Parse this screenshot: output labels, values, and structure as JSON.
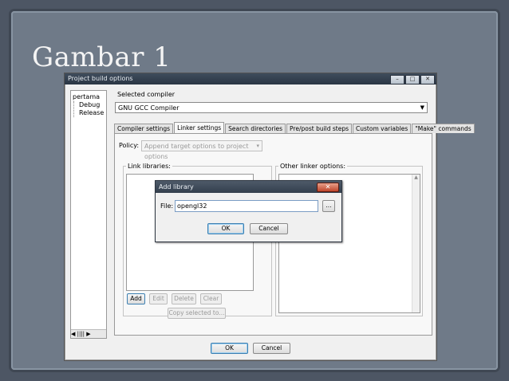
{
  "slide": {
    "title": "Gambar 1"
  },
  "window": {
    "title": "Project build options",
    "controls": [
      "–",
      "□",
      "✕"
    ]
  },
  "tree": {
    "root": "pertama",
    "items": [
      "Debug",
      "Release"
    ],
    "scroll_label": "◀ |||| ▶"
  },
  "compiler": {
    "label": "Selected compiler",
    "value": "GNU GCC Compiler"
  },
  "tabs": [
    {
      "label": "Compiler settings",
      "active": false
    },
    {
      "label": "Linker settings",
      "active": true
    },
    {
      "label": "Search directories",
      "active": false
    },
    {
      "label": "Pre/post build steps",
      "active": false
    },
    {
      "label": "Custom variables",
      "active": false
    },
    {
      "label": "\"Make\" commands",
      "active": false
    }
  ],
  "policy": {
    "label": "Policy:",
    "value": "Append target options to project options"
  },
  "link_libraries": {
    "label": "Link libraries:",
    "buttons": {
      "add": "Add",
      "edit": "Edit",
      "delete": "Delete",
      "clear": "Clear",
      "copy": "Copy selected to..."
    }
  },
  "other_linker": {
    "label": "Other linker options:"
  },
  "footer": {
    "ok": "OK",
    "cancel": "Cancel"
  },
  "dialog": {
    "title": "Add library",
    "close": "✕",
    "file_label": "File:",
    "file_value": "opengl32",
    "browse": "...",
    "ok": "OK",
    "cancel": "Cancel"
  }
}
